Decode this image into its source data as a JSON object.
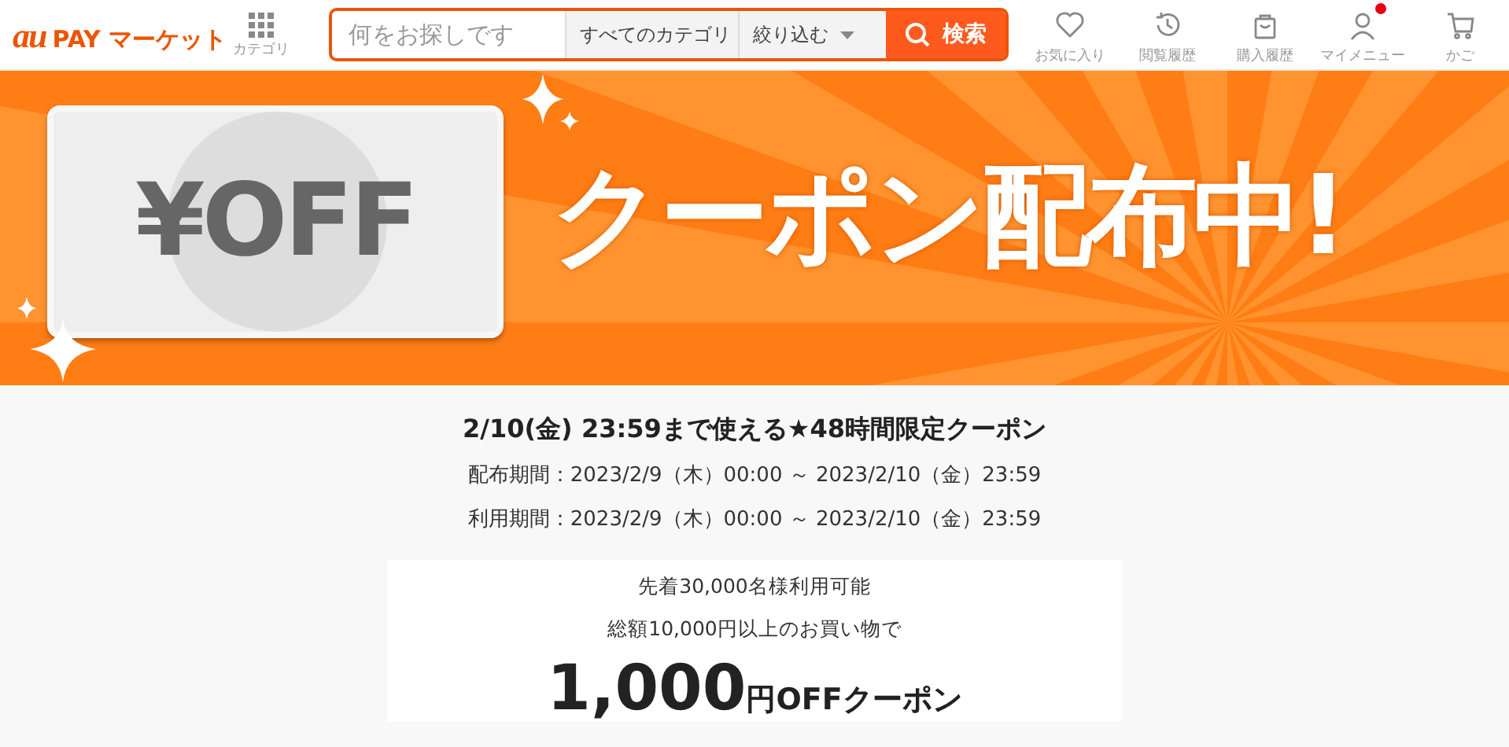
{
  "header": {
    "logo_mark": "au",
    "logo_text": "PAY マーケット",
    "category_label": "カテゴリ",
    "search": {
      "placeholder": "何をお探しです",
      "category": "すべてのカテゴリ",
      "filter": "絞り込む",
      "button": "検索"
    },
    "nav": [
      {
        "kind": "heart",
        "label": "お気に入り",
        "notify": false
      },
      {
        "kind": "history",
        "label": "閲覧履歴",
        "notify": false
      },
      {
        "kind": "bag",
        "label": "購入履歴",
        "notify": false
      },
      {
        "kind": "person",
        "label": "マイメニュー",
        "notify": true
      },
      {
        "kind": "cart",
        "label": "かご",
        "notify": false
      }
    ]
  },
  "banner": {
    "ticket": "¥OFF",
    "headline": "クーポン配布中!"
  },
  "coupon": {
    "title": "2/10(金) 23:59まで使える★48時間限定クーポン",
    "periods": [
      "配布期間：2023/2/9（木）00:00 ～ 2023/2/10（金）23:59",
      "利用期間：2023/2/9（木）00:00 ～ 2023/2/10（金）23:59"
    ],
    "card_lines": [
      "先着30,000名様利用可能",
      "総額10,000円以上のお買い物で"
    ],
    "amount": "1,000",
    "amount_suffix": "円OFFクーポン"
  }
}
